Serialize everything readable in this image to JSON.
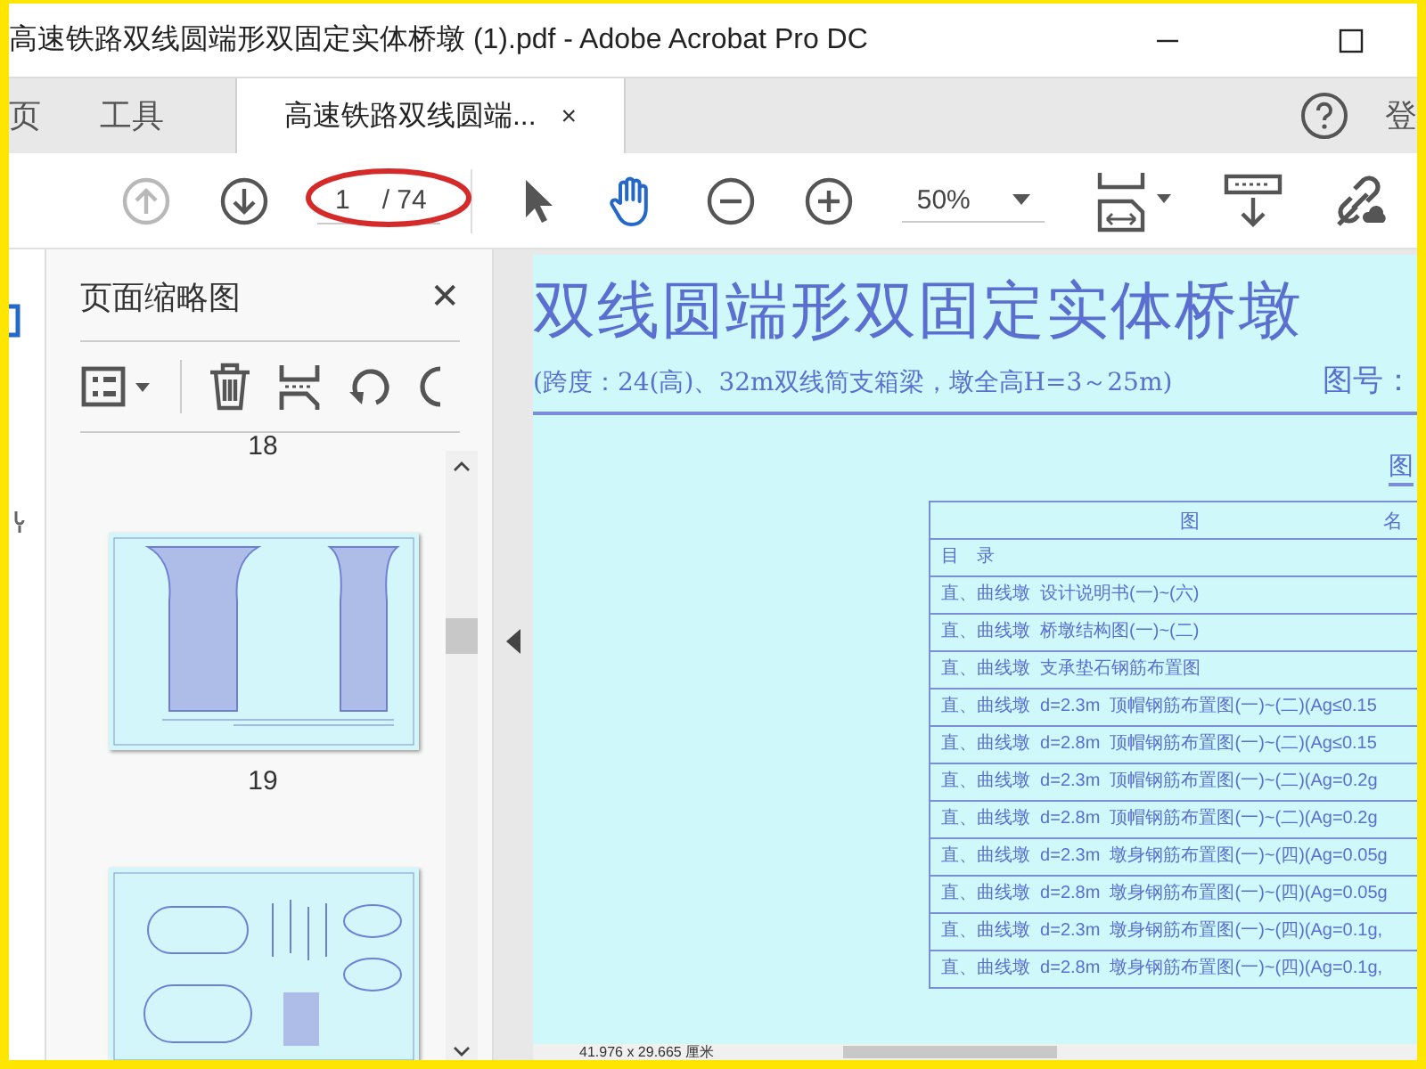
{
  "window": {
    "title": "高速铁路双线圆端形双固定实体桥墩 (1).pdf - Adobe Acrobat Pro DC"
  },
  "tabs": [
    {
      "label": "页",
      "selected": false,
      "kind": "nav"
    },
    {
      "label": "工具",
      "selected": false,
      "kind": "nav"
    },
    {
      "label": "高速铁路双线圆端...",
      "selected": true,
      "kind": "document",
      "close": "×"
    }
  ],
  "account": {
    "label": "登"
  },
  "toolbar": {
    "nav_buttons": [
      {
        "kind": "up",
        "disabled": true
      },
      {
        "kind": "down",
        "disabled": false
      }
    ],
    "page": "1",
    "page_total": "/ 74",
    "tools": [
      {
        "kind": "select",
        "selected": false
      },
      {
        "kind": "hand",
        "selected": true
      }
    ],
    "zoom": "50%"
  },
  "thumbnails_panel": {
    "title": "页面缩略图",
    "close": "✕",
    "items": [
      {
        "kind": "label",
        "text": "18"
      },
      {
        "kind": "elevation-thumb"
      },
      {
        "kind": "label",
        "text": "19"
      },
      {
        "kind": "plan-thumb"
      }
    ]
  },
  "document": {
    "title": "双线圆端形双固定实体桥墩",
    "subtitle": "(跨度：24(高)、32m双线简支箱梁，墩全高H=3～25m)",
    "drawing_number_label": "图号：",
    "corner_label": "图",
    "table": {
      "header": [
        "图",
        "名"
      ],
      "rows": [
        "目　录",
        "直、曲线墩  设计说明书(一)~(六)",
        "直、曲线墩  桥墩结构图(一)~(二)",
        "直、曲线墩  支承垫石钢筋布置图",
        "直、曲线墩  d=2.3m  顶帽钢筋布置图(一)~(二)(Ag≤0.15",
        "直、曲线墩  d=2.8m  顶帽钢筋布置图(一)~(二)(Ag≤0.15",
        "直、曲线墩  d=2.3m  顶帽钢筋布置图(一)~(二)(Ag=0.2g",
        "直、曲线墩  d=2.8m  顶帽钢筋布置图(一)~(二)(Ag=0.2g",
        "直、曲线墩  d=2.3m  墩身钢筋布置图(一)~(四)(Ag=0.05g",
        "直、曲线墩  d=2.8m  墩身钢筋布置图(一)~(四)(Ag=0.05g",
        "直、曲线墩  d=2.3m  墩身钢筋布置图(一)~(四)(Ag=0.1g,",
        "直、曲线墩  d=2.8m  墩身钢筋布置图(一)~(四)(Ag=0.1g,"
      ]
    }
  },
  "status_bar": {
    "page_size": "41.976 x 29.665 厘米"
  }
}
